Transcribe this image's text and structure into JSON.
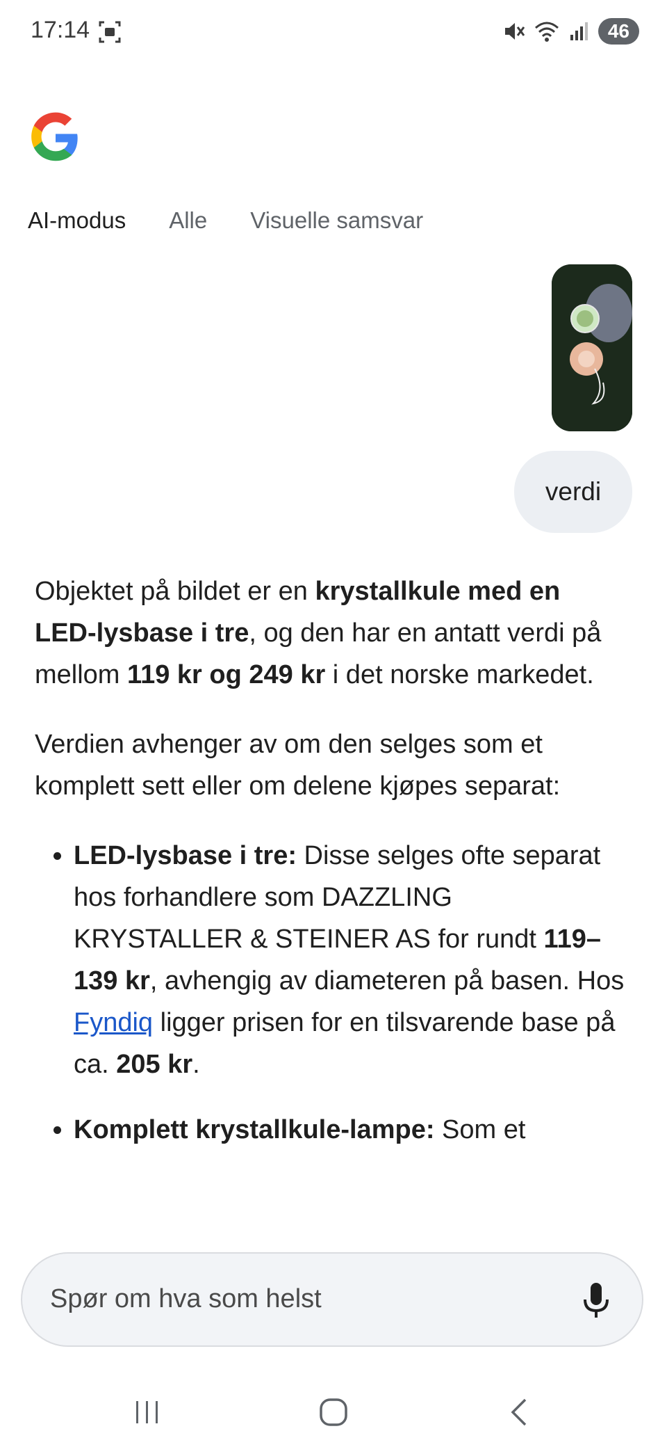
{
  "status": {
    "time": "17:14",
    "battery": "46"
  },
  "tabs": [
    {
      "label": "AI-modus"
    },
    {
      "label": "Alle"
    },
    {
      "label": "Visuelle samsvar"
    }
  ],
  "query": {
    "text": "verdi"
  },
  "answer": {
    "p1": {
      "a": "Objektet på bildet er en ",
      "b": "krystallkule med en LED-lysbase i tre",
      "c": ", og den har en antatt verdi på mellom ",
      "d": "119 kr og 249 kr",
      "e": " i det norske markedet."
    },
    "p2": "Verdien avhenger av om den selges som et komplett sett eller om delene kjøpes separat:",
    "bullet1": {
      "title": "LED-lysbase i tre:",
      "t1": " Disse selges ofte separat hos forhandlere som DAZZLING KRYSTALLER & STEINER AS for rundt ",
      "b1": "119–139 kr",
      "t2": ", avhengig av diameteren på basen. Hos ",
      "link": "Fyndiq",
      "t3": " ligger prisen for en tilsvarende base på ca. ",
      "b2": "205 kr",
      "t4": "."
    },
    "bullet2": {
      "title": "Komplett krystallkule-lampe:",
      "t1": " Som et"
    }
  },
  "search": {
    "placeholder": "Spør om hva som helst"
  },
  "icons": {
    "logo": "google-g-logo",
    "mic": "microphone-icon",
    "nav": [
      "recent-apps-icon",
      "home-icon",
      "back-icon"
    ]
  },
  "colors": {
    "link": "#1a57c9",
    "bubble": "#eceff3",
    "search_bg": "#f2f4f7"
  }
}
